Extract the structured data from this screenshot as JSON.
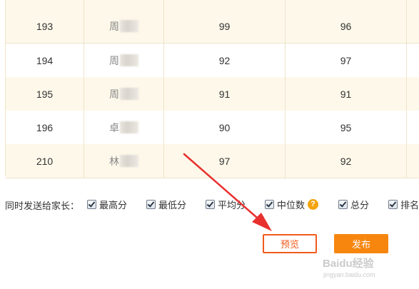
{
  "table": {
    "rows": [
      {
        "id": "193",
        "name": "周",
        "a": "99",
        "b": "96"
      },
      {
        "id": "194",
        "name": "周",
        "a": "92",
        "b": "97"
      },
      {
        "id": "195",
        "name": "周",
        "a": "91",
        "b": "91"
      },
      {
        "id": "196",
        "name": "卓",
        "a": "90",
        "b": "95"
      },
      {
        "id": "210",
        "name": "林",
        "a": "97",
        "b": "92"
      }
    ]
  },
  "options": {
    "lead": "同时发送给家长：",
    "items": [
      {
        "label": "最高分",
        "checked": true
      },
      {
        "label": "最低分",
        "checked": true
      },
      {
        "label": "平均分",
        "checked": true
      },
      {
        "label": "中位数",
        "checked": true
      },
      {
        "label": "总分",
        "checked": true
      },
      {
        "label": "排名",
        "checked": true
      }
    ],
    "help": "?"
  },
  "buttons": {
    "preview": "预览",
    "publish": "发布"
  },
  "watermark": {
    "main": "Baidu经验",
    "sub": "jingyan.baidu.com"
  },
  "colors": {
    "accent": "#f7860f",
    "preview_border": "#f05a1c",
    "row_alt": "#fdf8ea",
    "arrow": "#e8312f"
  }
}
